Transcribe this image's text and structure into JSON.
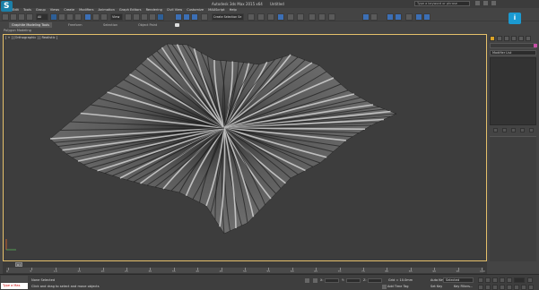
{
  "titlebar": {
    "app_title": "Autodesk 3ds Max  2015 x64",
    "file_name": "Untitled",
    "search_placeholder": "Type a keyword or phrase"
  },
  "menu": [
    "Edit",
    "Tools",
    "Group",
    "Views",
    "Create",
    "Modifiers",
    "Animation",
    "Graph Editors",
    "Rendering",
    "Civil View",
    "Customize",
    "MAXScript",
    "Help"
  ],
  "toolbar": {
    "selection_filter": "All",
    "reference_coord": "View",
    "named_selection": "Create Selection Se"
  },
  "ribbon": {
    "tabs": [
      "Graphite Modeling Tools",
      "Freeform",
      "Selection",
      "Object Paint"
    ],
    "sub_label": "Polygon Modeling"
  },
  "viewport": {
    "label": "[ + ] [Orthographic ] [ Realistic ]"
  },
  "command_panel": {
    "modifier_list": "Modifier List"
  },
  "timeline": {
    "frame_display": "0 / 100",
    "ticks": [
      "0",
      "5",
      "10",
      "15",
      "20",
      "25",
      "30",
      "35",
      "40",
      "45",
      "50",
      "55",
      "60",
      "65",
      "70",
      "75",
      "80",
      "85",
      "90",
      "95",
      "100"
    ]
  },
  "status": {
    "maxscript_label": "Type a Mas",
    "selection_status": "None Selected",
    "prompt": "Click and drag to select and move objects",
    "x_label": "X:",
    "y_label": "Y:",
    "z_label": "Z:",
    "grid": "Grid = 10.0mm",
    "add_time_tag": "Add Time Tag",
    "auto_key": "Auto Key",
    "set_key": "Set Key",
    "selected": "Selected",
    "key_filters": "Key Filters..."
  },
  "colors": {
    "accent": "#1b9ad1",
    "viewport_border": "#e5c06a",
    "surface": "#9a9a9a"
  }
}
